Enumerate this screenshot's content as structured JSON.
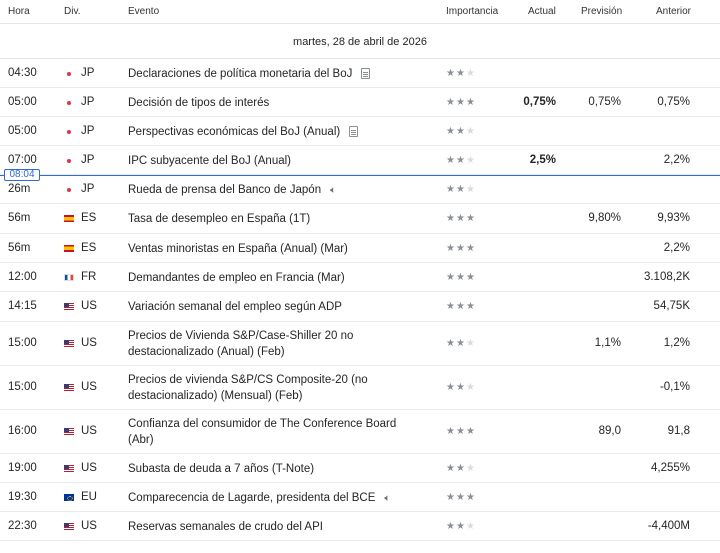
{
  "columns": {
    "time": "Hora",
    "currency": "Div.",
    "event": "Evento",
    "importance": "Importancia",
    "actual": "Actual",
    "forecast": "Previsión",
    "previous": "Anterior"
  },
  "date_heading": "martes, 28 de abril de 2026",
  "now_marker": "08:04",
  "colors": {
    "accent": "#2f6bd1",
    "jp_dot": "#e0324b",
    "star_on": "#8a8f95",
    "star_off": "#d9dcdf"
  },
  "events": [
    {
      "time": "04:30",
      "flag": "jp",
      "currency": "JP",
      "event": "Declaraciones de política monetaria del BoJ",
      "icon": "document-icon",
      "importance": 2,
      "actual": "",
      "forecast": "",
      "previous": ""
    },
    {
      "time": "05:00",
      "flag": "jp",
      "currency": "JP",
      "event": "Decisión de tipos de interés",
      "icon": "",
      "importance": 3,
      "actual": "0,75%",
      "forecast": "0,75%",
      "previous": "0,75%"
    },
    {
      "time": "05:00",
      "flag": "jp",
      "currency": "JP",
      "event": "Perspectivas económicas del BoJ (Anual)",
      "icon": "document-icon",
      "importance": 2,
      "actual": "",
      "forecast": "",
      "previous": ""
    },
    {
      "time": "07:00",
      "flag": "jp",
      "currency": "JP",
      "event": "IPC subyacente del BoJ (Anual)",
      "icon": "",
      "importance": 2,
      "actual": "2,5%",
      "forecast": "",
      "previous": "2,2%"
    },
    {
      "time": "26m",
      "flag": "jp",
      "currency": "JP",
      "event": "Rueda de prensa del Banco de Japón",
      "icon": "speaker-icon",
      "importance": 2,
      "actual": "",
      "forecast": "",
      "previous": ""
    },
    {
      "time": "56m",
      "flag": "es",
      "currency": "ES",
      "event": "Tasa de desempleo en España  (1T)",
      "icon": "",
      "importance": 3,
      "actual": "",
      "forecast": "9,80%",
      "previous": "9,93%"
    },
    {
      "time": "56m",
      "flag": "es",
      "currency": "ES",
      "event": "Ventas minoristas en España (Anual) (Mar)",
      "icon": "",
      "importance": 3,
      "actual": "",
      "forecast": "",
      "previous": "2,2%"
    },
    {
      "time": "12:00",
      "flag": "fr",
      "currency": "FR",
      "event": "Demandantes de empleo en Francia  (Mar)",
      "icon": "",
      "importance": 3,
      "actual": "",
      "forecast": "",
      "previous": "3.108,2K"
    },
    {
      "time": "14:15",
      "flag": "us",
      "currency": "US",
      "event": "Variación semanal del empleo según ADP",
      "icon": "",
      "importance": 3,
      "actual": "",
      "forecast": "",
      "previous": "54,75K"
    },
    {
      "time": "15:00",
      "flag": "us",
      "currency": "US",
      "event": "Precios de Vivienda S&P/Case-Shiller 20 no destacionalizado (Anual) (Feb)",
      "icon": "",
      "importance": 2,
      "actual": "",
      "forecast": "1,1%",
      "previous": "1,2%"
    },
    {
      "time": "15:00",
      "flag": "us",
      "currency": "US",
      "event": "Precios de vivienda S&P/CS Composite-20 (no destacionalizado) (Mensual) (Feb)",
      "icon": "",
      "importance": 2,
      "actual": "",
      "forecast": "",
      "previous": "-0,1%"
    },
    {
      "time": "16:00",
      "flag": "us",
      "currency": "US",
      "event": "Confianza del consumidor de The Conference Board (Abr)",
      "icon": "",
      "importance": 3,
      "actual": "",
      "forecast": "89,0",
      "previous": "91,8"
    },
    {
      "time": "19:00",
      "flag": "us",
      "currency": "US",
      "event": "Subasta de deuda a 7 años (T-Note)",
      "icon": "",
      "importance": 2,
      "actual": "",
      "forecast": "",
      "previous": "4,255%"
    },
    {
      "time": "19:30",
      "flag": "eu",
      "currency": "EU",
      "event": "Comparecencia de Lagarde, presidenta del BCE",
      "icon": "speaker-icon",
      "importance": 3,
      "actual": "",
      "forecast": "",
      "previous": ""
    },
    {
      "time": "22:30",
      "flag": "us",
      "currency": "US",
      "event": "Reservas semanales de crudo del API",
      "icon": "",
      "importance": 2,
      "actual": "",
      "forecast": "",
      "previous": "-4,400M"
    }
  ]
}
